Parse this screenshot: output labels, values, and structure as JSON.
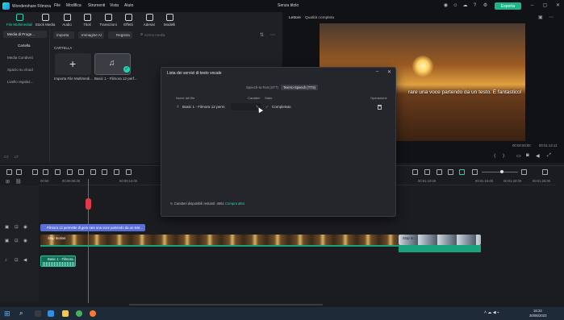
{
  "titlebar": {
    "app_name": "Wondershare Filmora",
    "menu": [
      "File",
      "Modifica",
      "Strumenti",
      "Vista",
      "Aiuto"
    ],
    "project_name": "Senza titolo",
    "export_label": "Esporta"
  },
  "toolbar": {
    "items": [
      {
        "label": "File Multimediali"
      },
      {
        "label": "Stock Media"
      },
      {
        "label": "Audio"
      },
      {
        "label": "Titoli"
      },
      {
        "label": "Transizioni"
      },
      {
        "label": "Effetti"
      },
      {
        "label": "Adesivi"
      },
      {
        "label": "Modelli"
      }
    ]
  },
  "leftnav": {
    "header": "Media di Proge...",
    "items": [
      "Cartella",
      "Media Condivisi",
      "Spazio su cloud",
      "Livello regolaz..."
    ]
  },
  "media": {
    "import_label": "Importa",
    "image_ai_label": "Immagine AI",
    "record_label": "Registra",
    "search_placeholder": "Cerca media",
    "folder_label": "CARTELLA",
    "items": [
      {
        "label": "Importa File Multimedi..."
      },
      {
        "label": "Basic 1 - Filmora 12 perf..."
      }
    ]
  },
  "preview": {
    "tab_player": "Lettore",
    "quality": "Qualità completa",
    "caption": "rare una voce partendo da un testo. È fantastico!",
    "time_current": "00:00:00:00",
    "time_total": "00:01:14:11"
  },
  "dialog": {
    "title": "Lista dei servizi di testo vocale",
    "tabs": [
      "Speech-to-Text (STT)",
      "Text-to-Speech (TTS)"
    ],
    "columns": [
      "Nome del file",
      "Caratteri",
      "Stato",
      "Operazione"
    ],
    "row": {
      "file_name": "Basic 1 - Filmora 12 perm",
      "status": "Completato"
    },
    "footer_text": "Caratteri disponibili restanti: 4561",
    "footer_link": "Compra altro"
  },
  "timeline": {
    "ruler": [
      "00:00",
      "00:00:05:00",
      "00:00:10:00",
      "00:00:15:00",
      "00:01:05:00",
      "00:01:10:00",
      "00:01:15:00",
      "00:01:20:00",
      "00:01:25:00"
    ],
    "text_clip": "Filmora 12 permette di generare una voce partendo da un test...",
    "video_clip": "Stop motion",
    "video_clip2": "Stop m...",
    "audio_clip": "Basic 1 - Filmora..."
  },
  "taskbar": {
    "time": "16:22",
    "date": "30/06/2023"
  },
  "colors": {
    "accent": "#1fd6b4",
    "export": "#1fb38a",
    "playhead": "#e03a4a",
    "text_clip": "#5a6fd8"
  }
}
